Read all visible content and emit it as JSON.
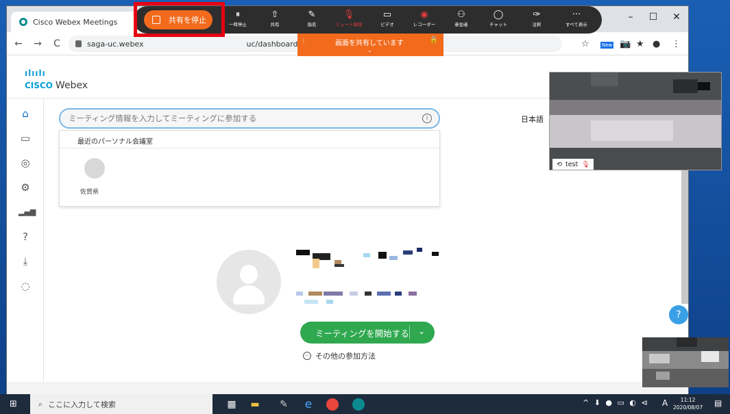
{
  "browser": {
    "tab_title": "Cisco Webex Meetings",
    "tab_close": "×",
    "url": "saga-uc.webex",
    "url_rest": "uc/dashboard/pmr/te",
    "window_controls": [
      "–",
      "☐",
      "✕"
    ],
    "nav": {
      "back": "←",
      "forward": "→",
      "reload": "C"
    },
    "extensions": [
      "☆",
      "New",
      "📷",
      "★",
      "●",
      "⋮"
    ]
  },
  "sharebar": {
    "stop_share_label": "共有を停止",
    "controls": [
      {
        "glyph": "⏸",
        "label": "一時停止",
        "icon": "pause-icon"
      },
      {
        "glyph": "⇧",
        "label": "共有",
        "icon": "share-icon"
      },
      {
        "glyph": "✎",
        "label": "指名",
        "icon": "assign-icon"
      },
      {
        "glyph": "🎙",
        "label": "ミュート解除",
        "icon": "mic-muted-icon",
        "muted": true
      },
      {
        "glyph": "▭",
        "label": "ビデオ",
        "icon": "video-icon"
      },
      {
        "glyph": "◉",
        "label": "レコーダー",
        "icon": "record-icon"
      },
      {
        "glyph": "⚇",
        "label": "参加者",
        "icon": "participants-icon"
      },
      {
        "glyph": "◯",
        "label": "チャット",
        "icon": "chat-icon"
      },
      {
        "glyph": "✑",
        "label": "注釈",
        "icon": "annotate-icon"
      },
      {
        "glyph": "···",
        "label": "すべて表示",
        "icon": "more-icon"
      }
    ],
    "banner_text": "画面を共有しています",
    "highlight_color": "#e60012",
    "accent_color": "#f26b1d"
  },
  "webex": {
    "logo_bars": "ılıılı",
    "logo_cisco": "CISCO",
    "logo_webex": "Webex",
    "search_placeholder": "ミーティング情報を入力してミーティングに参加する",
    "language": "日本語",
    "recent_header": "最近のパーソナル会議室",
    "recent_name": "佐賀県",
    "start_meeting": "ミーティングを開始する",
    "other_join": "その他の参加方法",
    "help": "?",
    "sidenav": [
      "home-icon",
      "meetings-icon",
      "recordings-icon",
      "settings-icon",
      "insights-icon",
      "help-icon",
      "download-icon",
      "feedback-icon"
    ]
  },
  "video": {
    "self_label": "test"
  },
  "taskbar": {
    "search_placeholder": "ここに入力して検索",
    "time": "11:12",
    "date": "2020/08/07",
    "ime": "A"
  }
}
